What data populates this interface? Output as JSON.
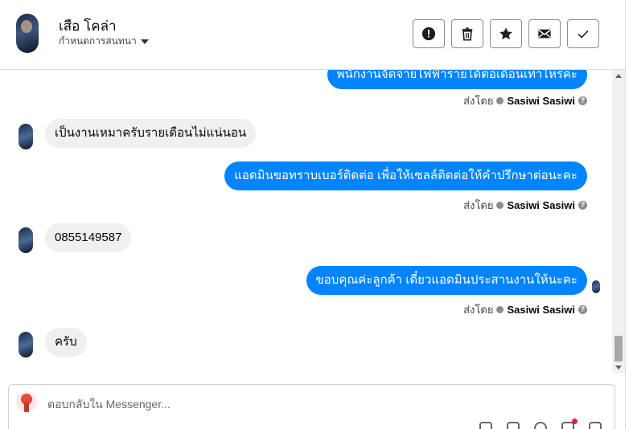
{
  "header": {
    "contact_name": "เสือ โคล่า",
    "subtitle": "กำหนดการสนทนา",
    "actions": [
      {
        "name": "report-button",
        "icon": "alert-icon"
      },
      {
        "name": "delete-button",
        "icon": "trash-icon"
      },
      {
        "name": "star-button",
        "icon": "star-icon"
      },
      {
        "name": "mark-unread-button",
        "icon": "envelope-icon"
      },
      {
        "name": "done-button",
        "icon": "check-icon"
      }
    ]
  },
  "messages": {
    "m1": {
      "text": "พนักงานจัดจ่ายไฟฟ้ารายได้ต่อเดือนเท่าไหร่คะ"
    },
    "m1_sent": {
      "prefix": "ส่งโดย",
      "name": "Sasiwi Sasiwi"
    },
    "m2": {
      "text": "เป็นงานเหมาครับรายเดือนไม่แน่นอน"
    },
    "m3": {
      "text": "แอดมินขอทราบเบอร์ติดต่อ เพื่อให้เซลล์ติดต่อให้คำปรึกษาต่อนะคะ"
    },
    "m3_sent": {
      "prefix": "ส่งโดย",
      "name": "Sasiwi Sasiwi"
    },
    "m4": {
      "text": "0855149587"
    },
    "m5": {
      "text": "ขอบคุณค่ะลูกค้า เดี๋ยวแอดมินประสานงานให้นะคะ"
    },
    "m5_sent": {
      "prefix": "ส่งโดย",
      "name": "Sasiwi Sasiwi"
    },
    "m6": {
      "text": "ครับ"
    },
    "help_glyph": "?"
  },
  "composer": {
    "placeholder": "ตอบกลับใน Messenger..."
  },
  "colors": {
    "outgoing_bubble": "#0084ff",
    "incoming_bubble": "#f0f0f0",
    "notification_dot": "#e41e3f"
  }
}
